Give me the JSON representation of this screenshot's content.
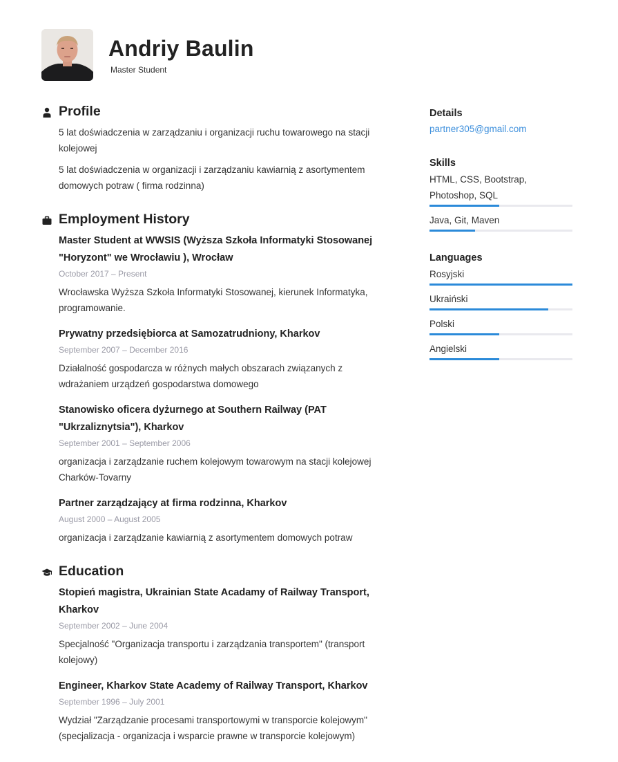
{
  "header": {
    "name": "Andriy Baulin",
    "title": "Master Student"
  },
  "profile": {
    "heading": "Profile",
    "paragraphs": [
      "5 lat doświadczenia w zarządzaniu i organizacji ruchu towarowego na stacji kolejowej",
      "5 lat doświadczenia w organizacji i zarządzaniu kawiarnią z asortymentem domowych potraw ( firma rodzinna)"
    ]
  },
  "employment": {
    "heading": "Employment History",
    "jobs": [
      {
        "title": "Master Student at WWSIS (Wyższa Szkoła Informatyki Stosowanej \"Horyzont\" we Wrocławiu ), Wrocław",
        "dates": "October 2017  –  Present",
        "desc": " Wrocławska Wyższa Szkoła Informatyki Stosowanej,  kierunek Informatyka, programowanie."
      },
      {
        "title": "Prywatny przedsiębiorca at Samozatrudniony, Kharkov",
        "dates": "September 2007  –  December 2016",
        "desc": "Działalność gospodarcza w różnych małych obszarach związanych z wdrażaniem urządzeń gospodarstwa domowego"
      },
      {
        "title": "Stanowisko oficera dyżurnego at Southern Railway (PAT \"Ukrzaliznytsia\"), Kharkov",
        "dates": "September 2001  –  September 2006",
        "desc": "organizacja i zarządzanie ruchem kolejowym towarowym na stacji kolejowej Charków-Tovarny"
      },
      {
        "title": "Partner zarządzający at firma rodzinna, Kharkov",
        "dates": "August 2000  –  August 2005",
        "desc": "organizacja i zarządzanie kawiarnią z asortymentem domowych potraw"
      }
    ]
  },
  "education": {
    "heading": "Education",
    "items": [
      {
        "title": "Stopień magistra, Ukrainian State Acadamy of Railway Transport, Kharkov",
        "dates": "September 2002  –  June 2004",
        "desc": "Specjalność  \"Organizacja transportu i zarządzania transportem\" (transport kolejowy)"
      },
      {
        "title": "Engineer, Kharkov State Academy of Railway Transport, Kharkov",
        "dates": "September 1996  –  July 2001",
        "desc": "Wydział \"Zarządzanie procesami transportowymi w transporcie kolejowym\" (specjalizacja - organizacja i wsparcie prawne w transporcie kolejowym)"
      }
    ]
  },
  "sidebar": {
    "details_heading": "Details",
    "email": "partner305@gmail.com",
    "skills_heading": "Skills",
    "skills": [
      {
        "name": "HTML, CSS, Bootstrap, Photoshop, SQL",
        "level": 0.49
      },
      {
        "name": "Java, Git, Maven",
        "level": 0.32
      }
    ],
    "languages_heading": "Languages",
    "languages": [
      {
        "name": "Rosyjski",
        "level": 1.0
      },
      {
        "name": "Ukraiński",
        "level": 0.83
      },
      {
        "name": "Polski",
        "level": 0.49
      },
      {
        "name": "Angielski",
        "level": 0.49
      }
    ]
  },
  "colors": {
    "accent": "#2b8ad9",
    "link": "#3d8fdc",
    "dates": "#9a9aa6"
  }
}
